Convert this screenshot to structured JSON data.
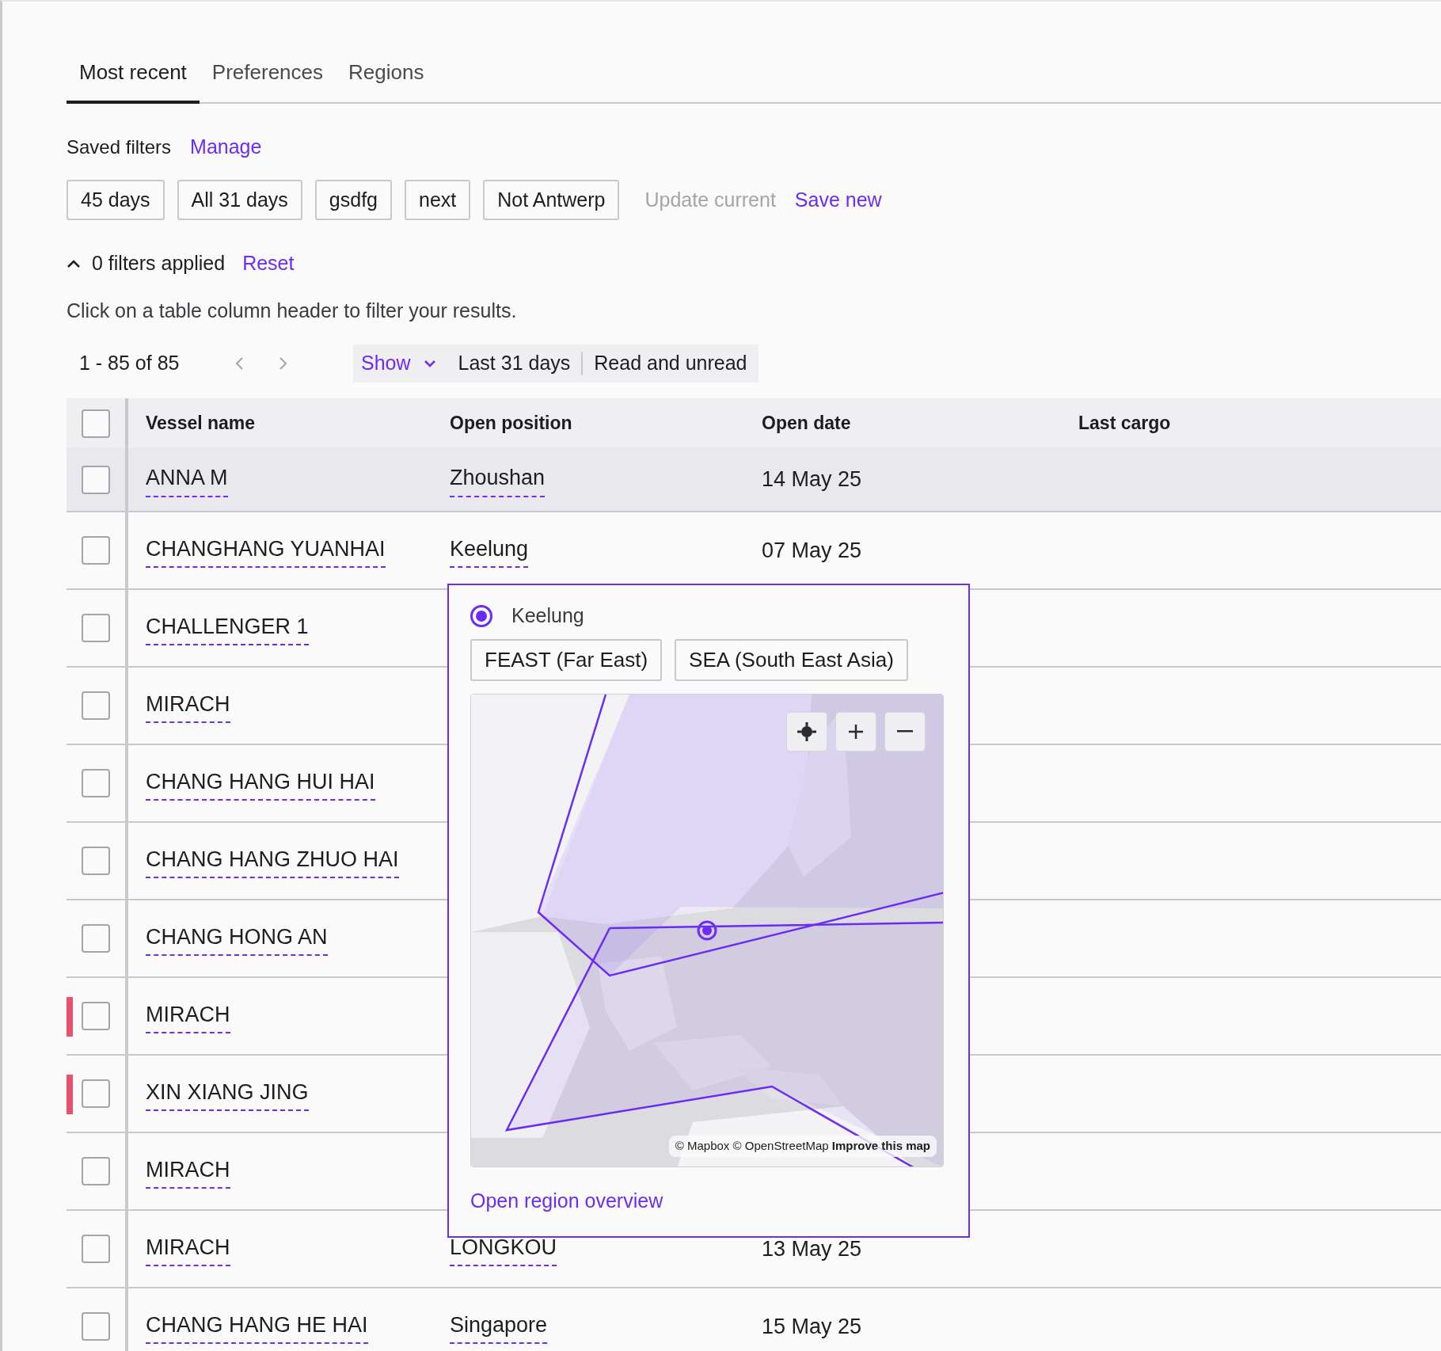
{
  "tabs": [
    {
      "label": "Most recent",
      "selected": true
    },
    {
      "label": "Preferences",
      "selected": false
    },
    {
      "label": "Regions",
      "selected": false
    }
  ],
  "saved_filters": {
    "title": "Saved filters",
    "manage": "Manage",
    "filters": [
      "45 days",
      "All 31 days",
      "gsdfg",
      "next",
      "Not Antwerp"
    ],
    "update": {
      "label": "Update current",
      "disabled": true
    },
    "save_new": "Save new"
  },
  "filters_applied": {
    "expanded": true,
    "label": "0 filters applied",
    "reset": "Reset"
  },
  "hint": "Click on a table column header to filter your results.",
  "pagination": {
    "range": "1 - 85 of 85",
    "prev_disabled": true,
    "next_disabled": true
  },
  "view_options": {
    "show": "Show",
    "period": "Last 31 days",
    "read": "Read and unread"
  },
  "table": {
    "columns": [
      "Vessel name",
      "Open position",
      "Open date",
      "Last cargo"
    ],
    "header_checked": false,
    "rows": [
      {
        "vessel": "ANNA M",
        "position": "Zhoushan",
        "date": "14 May 25",
        "checked": false,
        "flagged": false,
        "highlighted": true
      },
      {
        "vessel": "CHANGHANG YUANHAI",
        "position": "Keelung",
        "date": "07 May 25",
        "checked": false,
        "flagged": false,
        "highlighted": false
      },
      {
        "vessel": "CHALLENGER 1",
        "checked": false,
        "flagged": false,
        "highlighted": false
      },
      {
        "vessel": "MIRACH",
        "checked": false,
        "flagged": false,
        "highlighted": false
      },
      {
        "vessel": "CHANG HANG HUI HAI",
        "checked": false,
        "flagged": false,
        "highlighted": false
      },
      {
        "vessel": "CHANG HANG ZHUO HAI",
        "checked": false,
        "flagged": false,
        "highlighted": false
      },
      {
        "vessel": "CHANG HONG AN",
        "checked": false,
        "flagged": false,
        "highlighted": false
      },
      {
        "vessel": "MIRACH",
        "checked": false,
        "flagged": true,
        "highlighted": false
      },
      {
        "vessel": "XIN XIANG JING",
        "checked": false,
        "flagged": true,
        "highlighted": false
      },
      {
        "vessel": "MIRACH",
        "checked": false,
        "flagged": false,
        "highlighted": false
      },
      {
        "vessel": "MIRACH",
        "position": "LONGKOU",
        "date": "13 May 25",
        "checked": false,
        "flagged": false,
        "highlighted": false
      },
      {
        "vessel": "CHANG HANG HE HAI",
        "position": "Singapore",
        "date": "15 May 25",
        "checked": false,
        "flagged": false,
        "highlighted": false
      }
    ]
  },
  "popover": {
    "port": "Keelung",
    "selected": true,
    "regions": [
      "FEAST (Far East)",
      "SEA (South East Asia)"
    ],
    "map": {
      "kind": "picture",
      "attribution": "© Mapbox © OpenStreetMap",
      "improve": "Improve this map"
    },
    "link": "Open region overview"
  }
}
